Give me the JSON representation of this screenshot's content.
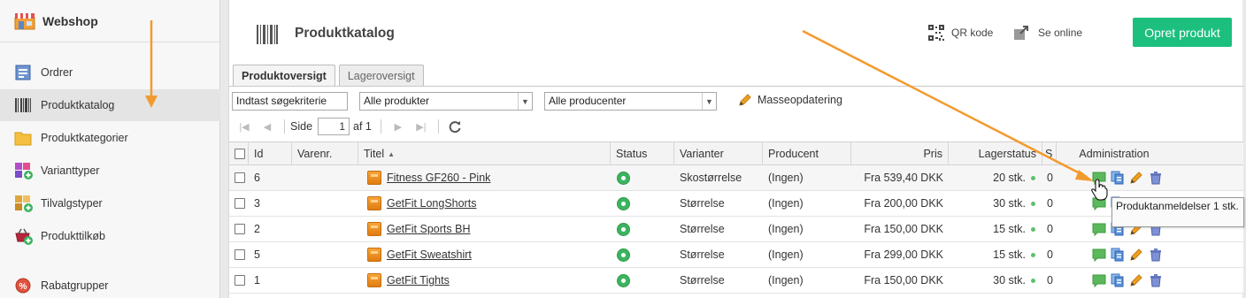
{
  "app": {
    "title": "Webshop"
  },
  "sidebar": {
    "items": [
      {
        "label": "Ordrer"
      },
      {
        "label": "Produktkatalog"
      },
      {
        "label": "Produktkategorier"
      },
      {
        "label": "Varianttyper"
      },
      {
        "label": "Tilvalgstyper"
      },
      {
        "label": "Produkttilkøb"
      },
      {
        "label": "Rabatgrupper"
      }
    ]
  },
  "header": {
    "title": "Produktkatalog",
    "qr_label": "QR kode",
    "online_label": "Se online",
    "create_label": "Opret produkt"
  },
  "tabs": [
    {
      "label": "Produktoversigt"
    },
    {
      "label": "Lageroversigt"
    }
  ],
  "filters": {
    "search_value": "Indtast søgekriterie",
    "products_selected": "Alle produkter",
    "producers_selected": "Alle producenter",
    "mass_update_label": "Masseopdatering"
  },
  "pager": {
    "page_label": "Side",
    "page_value": "1",
    "of_label": "af 1"
  },
  "table": {
    "headers": {
      "id": "Id",
      "varenr": "Varenr.",
      "title": "Titel",
      "status": "Status",
      "variants": "Varianter",
      "producer": "Producent",
      "price": "Pris",
      "stock": "Lagerstatus",
      "s": "S",
      "admin": "Administration"
    },
    "rows": [
      {
        "id": "6",
        "varenr": "",
        "title": "Fitness GF260 - Pink",
        "variants": "Skostørrelse",
        "producer": "(Ingen)",
        "price": "Fra 539,40 DKK",
        "stock": "20 stk.",
        "s": "0"
      },
      {
        "id": "3",
        "varenr": "",
        "title": "GetFit LongShorts",
        "variants": "Størrelse",
        "producer": "(Ingen)",
        "price": "Fra 200,00 DKK",
        "stock": "30 stk.",
        "s": "0"
      },
      {
        "id": "2",
        "varenr": "",
        "title": "GetFit Sports BH",
        "variants": "Størrelse",
        "producer": "(Ingen)",
        "price": "Fra 150,00 DKK",
        "stock": "15 stk.",
        "s": "0"
      },
      {
        "id": "5",
        "varenr": "",
        "title": "GetFit Sweatshirt",
        "variants": "Størrelse",
        "producer": "(Ingen)",
        "price": "Fra 299,00 DKK",
        "stock": "15 stk.",
        "s": "0"
      },
      {
        "id": "1",
        "varenr": "",
        "title": "GetFit Tights",
        "variants": "Størrelse",
        "producer": "(Ingen)",
        "price": "Fra 150,00 DKK",
        "stock": "30 stk.",
        "s": "0"
      }
    ]
  },
  "tooltip": {
    "text": "Produktanmeldelser 1 stk."
  },
  "colors": {
    "accent": "#1dbf7f",
    "arrow": "#f39a2e",
    "status_ok": "#3db35f"
  }
}
